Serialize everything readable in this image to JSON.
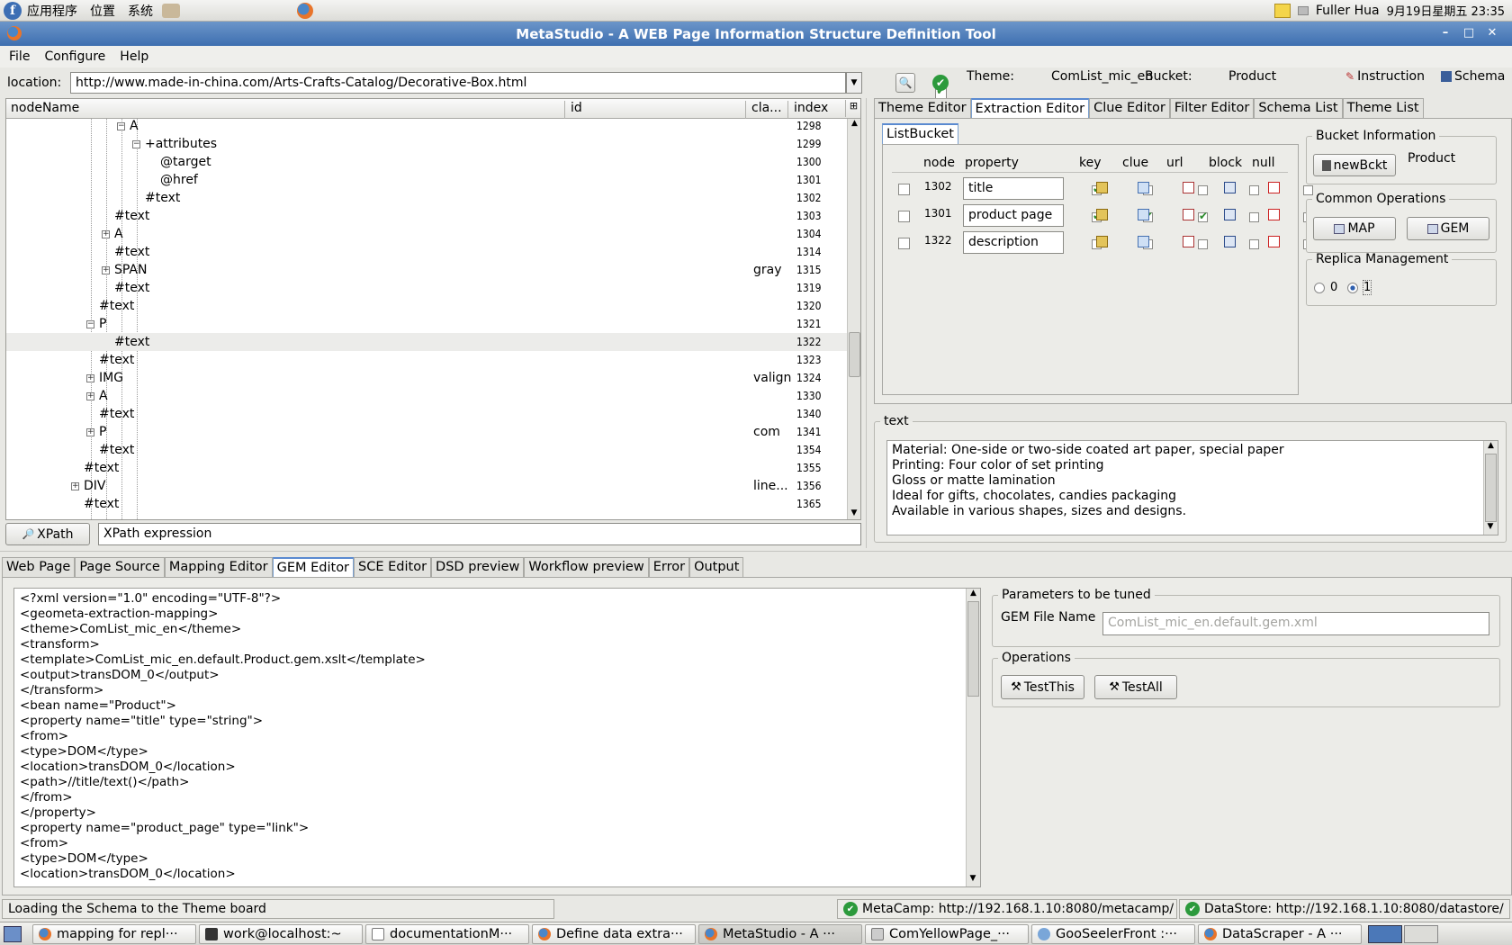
{
  "topbar": {
    "menus": [
      "应用程序",
      "位置",
      "系统"
    ],
    "user": "Fuller Hua",
    "datetime": "9月19日星期五 23:35"
  },
  "window": {
    "title": "MetaStudio - A WEB Page Information Structure Definition Tool"
  },
  "menubar": [
    "File",
    "Configure",
    "Help"
  ],
  "location": {
    "label": "location:",
    "url": "http://www.made-in-china.com/Arts-Crafts-Catalog/Decorative-Box.html",
    "theme_label": "Theme:",
    "theme": "ComList_mic_en",
    "bucket_label": "Bucket:",
    "bucket": "Product",
    "instruction": "Instruction",
    "schema": "Schema"
  },
  "tree": {
    "columns": [
      "nodeName",
      "id",
      "cla...",
      "index"
    ],
    "rows": [
      {
        "name": "A",
        "depth": 12,
        "exp": "minus",
        "cls": "",
        "index": "1298"
      },
      {
        "name": "+attributes",
        "depth": 13,
        "exp": "minus",
        "cls": "",
        "index": "1299"
      },
      {
        "name": "@target",
        "depth": 14,
        "exp": "",
        "cls": "",
        "index": "1300"
      },
      {
        "name": "@href",
        "depth": 14,
        "exp": "",
        "cls": "",
        "index": "1301"
      },
      {
        "name": "#text",
        "depth": 13,
        "exp": "",
        "cls": "",
        "index": "1302"
      },
      {
        "name": "#text",
        "depth": 11,
        "exp": "",
        "cls": "",
        "index": "1303"
      },
      {
        "name": "A",
        "depth": 11,
        "exp": "plus",
        "cls": "",
        "index": "1304"
      },
      {
        "name": "#text",
        "depth": 11,
        "exp": "",
        "cls": "",
        "index": "1314"
      },
      {
        "name": "SPAN",
        "depth": 11,
        "exp": "plus",
        "cls": "gray",
        "index": "1315"
      },
      {
        "name": "#text",
        "depth": 11,
        "exp": "",
        "cls": "",
        "index": "1319"
      },
      {
        "name": "#text",
        "depth": 10,
        "exp": "",
        "cls": "",
        "index": "1320"
      },
      {
        "name": "P",
        "depth": 10,
        "exp": "minus",
        "cls": "",
        "index": "1321"
      },
      {
        "name": "#text",
        "depth": 11,
        "exp": "",
        "cls": "",
        "index": "1322",
        "selected": true
      },
      {
        "name": "#text",
        "depth": 10,
        "exp": "",
        "cls": "",
        "index": "1323"
      },
      {
        "name": "IMG",
        "depth": 10,
        "exp": "plus",
        "cls": "valign",
        "index": "1324"
      },
      {
        "name": "A",
        "depth": 10,
        "exp": "plus",
        "cls": "",
        "index": "1330"
      },
      {
        "name": "#text",
        "depth": 10,
        "exp": "",
        "cls": "",
        "index": "1340"
      },
      {
        "name": "P",
        "depth": 10,
        "exp": "plus",
        "cls": "com",
        "index": "1341"
      },
      {
        "name": "#text",
        "depth": 10,
        "exp": "",
        "cls": "",
        "index": "1354"
      },
      {
        "name": "#text",
        "depth": 9,
        "exp": "",
        "cls": "",
        "index": "1355"
      },
      {
        "name": "DIV",
        "depth": 9,
        "exp": "plus",
        "cls": "line...",
        "index": "1356"
      },
      {
        "name": "#text",
        "depth": 9,
        "exp": "",
        "cls": "",
        "index": "1365"
      }
    ]
  },
  "xpath": {
    "button": "XPath",
    "placeholder": "XPath expression"
  },
  "right_tabs": [
    "Theme Editor",
    "Extraction Editor",
    "Clue Editor",
    "Filter Editor",
    "Schema List",
    "Theme List"
  ],
  "right_active": 1,
  "listbucket": {
    "tab": "ListBucket",
    "headers": [
      "node",
      "property",
      "key",
      "clue",
      "url",
      "block",
      "null"
    ],
    "rows": [
      {
        "node": "1302",
        "property": "title",
        "key": true,
        "clue": false,
        "url": false,
        "block": false,
        "null": false
      },
      {
        "node": "1301",
        "property": "product page",
        "key": true,
        "clue": true,
        "url": true,
        "block": false,
        "null": false
      },
      {
        "node": "1322",
        "property": "description",
        "key": false,
        "clue": false,
        "url": false,
        "block": false,
        "null": false
      }
    ]
  },
  "bucket_info": {
    "legend": "Bucket Information",
    "button": "newBckt",
    "value": "Product"
  },
  "common_ops": {
    "legend": "Common Operations",
    "map": "MAP",
    "gem": "GEM"
  },
  "replica": {
    "legend": "Replica Management",
    "opt0": "0",
    "opt1": "1",
    "selected": "1"
  },
  "text_panel": {
    "legend": "text",
    "lines": [
      "Material: One-side or two-side coated art paper, special paper",
      "Printing: Four color of set printing",
      "Gloss or matte lamination",
      "Ideal for gifts, chocolates, candies packaging",
      "Available in various shapes, sizes and designs."
    ]
  },
  "bottom_tabs": [
    "Web Page",
    "Page Source",
    "Mapping Editor",
    "GEM Editor",
    "SCE Editor",
    "DSD preview",
    "Workflow preview",
    "Error",
    "Output"
  ],
  "bottom_active": 3,
  "gem_code": [
    "<?xml version=\"1.0\" encoding=\"UTF-8\"?>",
    "<geometa-extraction-mapping>",
    "<theme>ComList_mic_en</theme>",
    "<transform>",
    "<template>ComList_mic_en.default.Product.gem.xslt</template>",
    "<output>transDOM_0</output>",
    "</transform>",
    "<bean name=\"Product\">",
    "<property name=\"title\" type=\"string\">",
    "<from>",
    "<type>DOM</type>",
    "<location>transDOM_0</location>",
    "<path>//title/text()</path>",
    "</from>",
    "</property>",
    "<property name=\"product_page\" type=\"link\">",
    "<from>",
    "<type>DOM</type>",
    "<location>transDOM_0</location>"
  ],
  "params": {
    "legend": "Parameters to be tuned",
    "label": "GEM File Name",
    "placeholder": "ComList_mic_en.default.gem.xml"
  },
  "operations": {
    "legend": "Operations",
    "test_this": "TestThis",
    "test_all": "TestAll"
  },
  "status": {
    "message": "Loading the Schema to the Theme board",
    "metacamp": "MetaCamp: http://192.168.1.10:8080/metacamp/",
    "datastore": "DataStore: http://192.168.1.10:8080/datastore/"
  },
  "taskbar": [
    "mapping for repl···",
    "work@localhost:~",
    "documentationM···",
    "Define data extra···",
    "MetaStudio - A ···",
    "ComYellowPage_···",
    "GooSeelerFront :···",
    "DataScraper - A ···"
  ]
}
